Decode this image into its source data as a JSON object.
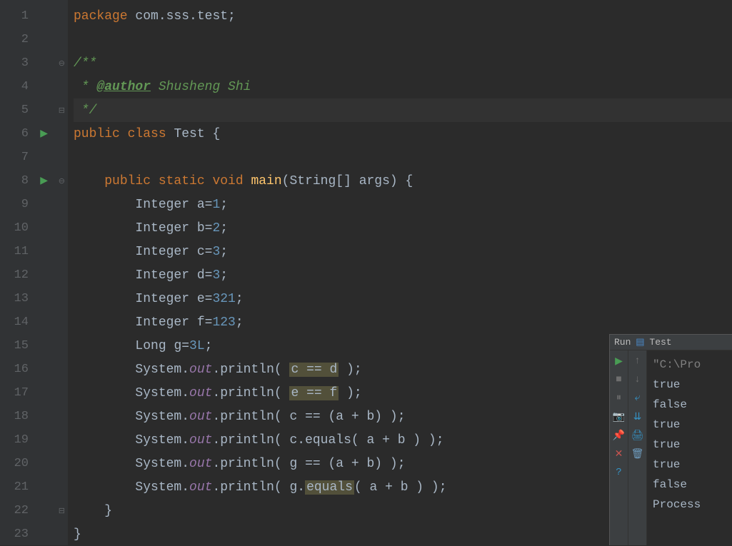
{
  "lines": {
    "count": 23
  },
  "code": {
    "l1": {
      "kw1": "package ",
      "pkg": "com.sss.test",
      "semi": ";"
    },
    "l3": {
      "c": "/**"
    },
    "l4": {
      "c1": " * ",
      "tag": "@author",
      "c2": " Shusheng Shi"
    },
    "l5": {
      "c": " */"
    },
    "l6": {
      "kw1": "public class ",
      "name": "Test ",
      "brace": "{"
    },
    "l8": {
      "indent": "    ",
      "kw1": "public static void ",
      "method": "main",
      "params": "(String[] args) {"
    },
    "l9": {
      "indent": "        ",
      "type": "Integer ",
      "var": "a=",
      "val": "1",
      "semi": ";"
    },
    "l10": {
      "indent": "        ",
      "type": "Integer ",
      "var": "b=",
      "val": "2",
      "semi": ";"
    },
    "l11": {
      "indent": "        ",
      "type": "Integer ",
      "var": "c=",
      "val": "3",
      "semi": ";"
    },
    "l12": {
      "indent": "        ",
      "type": "Integer ",
      "var": "d=",
      "val": "3",
      "semi": ";"
    },
    "l13": {
      "indent": "        ",
      "type": "Integer ",
      "var": "e=",
      "val": "321",
      "semi": ";"
    },
    "l14": {
      "indent": "        ",
      "type": "Integer ",
      "var": "f=",
      "val": "123",
      "semi": ";"
    },
    "l15": {
      "indent": "        ",
      "type": "Long ",
      "var": "g=",
      "val": "3L",
      "semi": ";"
    },
    "l16": {
      "indent": "        ",
      "sys": "System.",
      "out": "out",
      "dot": ".println( ",
      "arg1": "c ",
      "op": "== ",
      "arg2": "d",
      "end": " );"
    },
    "l17": {
      "indent": "        ",
      "sys": "System.",
      "out": "out",
      "dot": ".println( ",
      "arg1": "e ",
      "op": "== ",
      "arg2": "f",
      "end": " );"
    },
    "l18": {
      "indent": "        ",
      "sys": "System.",
      "out": "out",
      "dot": ".println( c == (a + b) );"
    },
    "l19": {
      "indent": "        ",
      "sys": "System.",
      "out": "out",
      "dot": ".println( c.equals( a + b ) );"
    },
    "l20": {
      "indent": "        ",
      "sys": "System.",
      "out": "out",
      "dot": ".println( g == (a + b) );"
    },
    "l21": {
      "indent": "        ",
      "sys": "System.",
      "out": "out",
      "dot": ".println( g.",
      "eq": "equals",
      "rest": "( a + b ) );"
    },
    "l22": {
      "indent": "    ",
      "brace": "}"
    },
    "l23": {
      "brace": "}"
    }
  },
  "run": {
    "label": "Run",
    "config": "Test",
    "output": {
      "line1": "\"C:\\Pro",
      "line2": "true",
      "line3": "false",
      "line4": "true",
      "line5": "true",
      "line6": "true",
      "line7": "false",
      "line8": "",
      "line9": "Process"
    }
  }
}
